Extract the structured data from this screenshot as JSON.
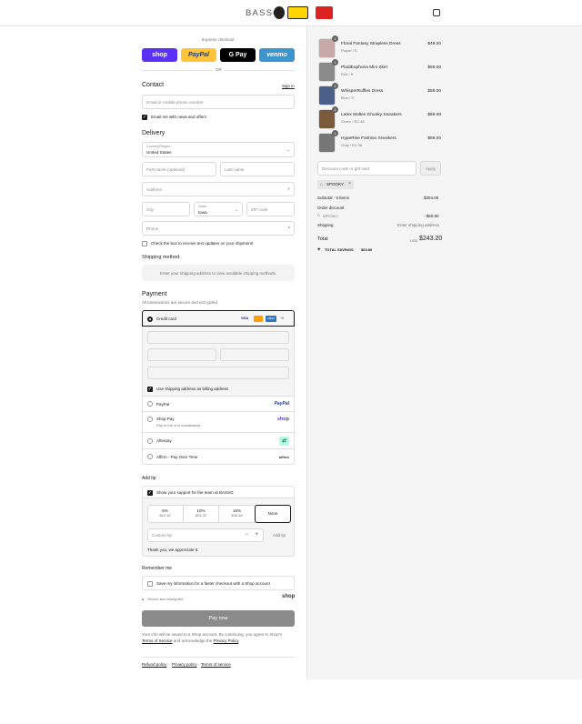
{
  "header": {
    "brand": "BASSO",
    "cart_icon": "bag-icon"
  },
  "express": {
    "title": "Express checkout",
    "buttons": [
      "shop",
      "PayPal",
      "G Pay",
      "venmo"
    ],
    "colors": {
      "shop": "#5a31f4",
      "paypal": "#ffc439",
      "gpay": "#000000",
      "venmo": "#3d95ce"
    },
    "or": "OR"
  },
  "contact": {
    "title": "Contact",
    "sign_in": "Sign in",
    "email_placeholder": "Email or mobile phone number",
    "news_label": "Email me with news and offers"
  },
  "delivery": {
    "title": "Delivery",
    "country_label": "Country/Region",
    "country_value": "United States",
    "first_name": "First name (optional)",
    "last_name": "Last name",
    "address": "Address",
    "city": "City",
    "state_label": "State",
    "state_value": "Iowa",
    "zip": "ZIP code",
    "phone": "Phone",
    "sms_label": "Check the box to receive text updates on your shipment!"
  },
  "shipping_method": {
    "title": "Shipping method",
    "note": "Enter your shipping address to view available shipping methods."
  },
  "payment": {
    "title": "Payment",
    "subtitle": "All transactions are secure and encrypted.",
    "credit_card": "Credit card",
    "card_brands": [
      "VISA",
      "MC",
      "AMEX",
      "+5"
    ],
    "billing_label": "Use shipping address as billing address",
    "paypal": "PayPal",
    "paypal_logo": "PayPal",
    "shop_pay": "Shop Pay",
    "shop_pay_sub": "Pay in full or in installments",
    "shop_logo": "shop",
    "afterpay": "Afterpay",
    "affirm": "Affirm - Pay Over Time",
    "affirm_logo": "affirm"
  },
  "tip": {
    "title": "Add tip",
    "support_label": "Show your support for the team at BASSO",
    "options": [
      {
        "pct": "5%",
        "amt": "$12.16"
      },
      {
        "pct": "10%",
        "amt": "$24.32"
      },
      {
        "pct": "15%",
        "amt": "$36.48"
      },
      {
        "pct": "None",
        "amt": ""
      }
    ],
    "custom_placeholder": "Custom tip",
    "add_label": "Add tip",
    "thanks": "Thank you, we appreciate it."
  },
  "remember": {
    "title": "Remember me",
    "save_label": "Save my information for a faster checkout with a Shop account",
    "secure": "Secure and encrypted",
    "shop_logo": "shop"
  },
  "pay_now": "Pay now",
  "legal": {
    "line1": "Your info will be saved to a Shop account. By continuing, you agree to Shop's",
    "terms": "Terms of Service",
    "and": "and acknowledge the",
    "privacy": "Privacy Policy",
    "period": "."
  },
  "footer_links": [
    "Refund policy",
    "Privacy policy",
    "Terms of service"
  ],
  "summary": {
    "items": [
      {
        "name": "Floral Fantasy Strapless Dress",
        "variant": "Purple / S",
        "price": "$49.00",
        "qty": "1"
      },
      {
        "name": "PlaidEuphoria Mini Skirt",
        "variant": "Red / S",
        "price": "$58.00",
        "qty": "1"
      },
      {
        "name": "WhisperRuffles Dress",
        "variant": "Blue / S",
        "price": "$59.00",
        "qty": "1"
      },
      {
        "name": "Latex Molten Chunky Sneakers",
        "variant": "Green / EU 46",
        "price": "$69.00",
        "qty": "1"
      },
      {
        "name": "HypeRise Fashion Sneakers",
        "variant": "Gray / EU 36",
        "price": "$69.00",
        "qty": "1"
      }
    ],
    "discount_placeholder": "Discount code or gift card",
    "apply": "Apply",
    "code_chip": "SPOOKY",
    "subtotal_label": "Subtotal · 5 items",
    "subtotal_value": "$304.00",
    "order_discount": "Order discount",
    "discount_code": "SPOOKY",
    "discount_value": "- $60.80",
    "shipping_label": "Shipping",
    "shipping_value": "Enter shipping address",
    "total_label": "Total",
    "currency": "USD",
    "total_value": "$243.20",
    "savings_label": "TOTAL SAVINGS",
    "savings_value": "$60.80"
  }
}
